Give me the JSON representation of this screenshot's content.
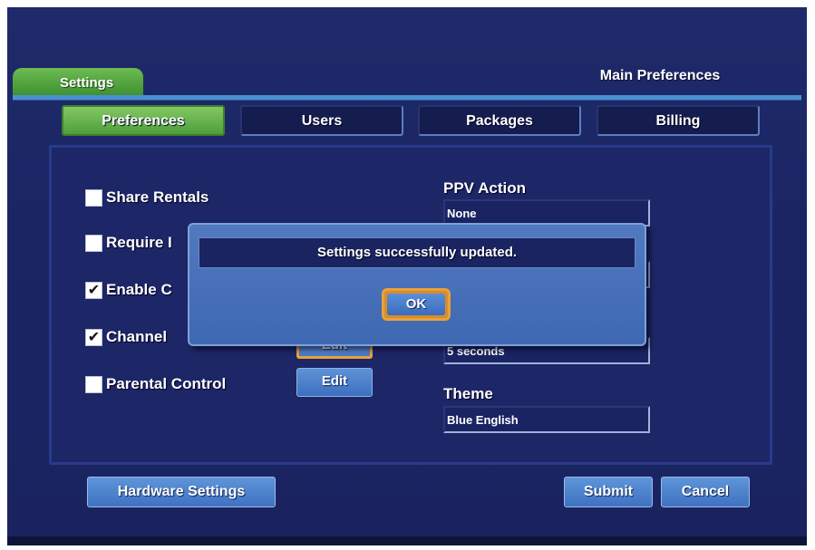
{
  "header": {
    "section_tab": "Settings",
    "page_title": "Main Preferences"
  },
  "tabs": [
    {
      "label": "Preferences",
      "active": true
    },
    {
      "label": "Users",
      "active": false
    },
    {
      "label": "Packages",
      "active": false
    },
    {
      "label": "Billing",
      "active": false
    }
  ],
  "options": [
    {
      "label": "Share Rentals",
      "checked": false
    },
    {
      "label": "Require I",
      "checked": false
    },
    {
      "label": "Enable C",
      "checked": true
    },
    {
      "label": "Channel",
      "checked": true
    },
    {
      "label": "Parental Control",
      "checked": false
    }
  ],
  "edit_buttons": {
    "channel_blocking": "Edit",
    "parental_control": "Edit"
  },
  "fields": {
    "ppv_action": {
      "label": "PPV Action",
      "value": "None"
    },
    "timeout": {
      "value": "5 seconds"
    },
    "theme": {
      "label": "Theme",
      "value": "Blue English"
    }
  },
  "footer": {
    "hardware_settings": "Hardware Settings",
    "submit": "Submit",
    "cancel": "Cancel"
  },
  "dialog": {
    "message": "Settings successfully updated.",
    "ok": "OK"
  },
  "colors": {
    "background": "#1f2a6a",
    "active_tab": "#6dbb52",
    "button": "#4a7ec8",
    "focus": "#e8a23a"
  }
}
